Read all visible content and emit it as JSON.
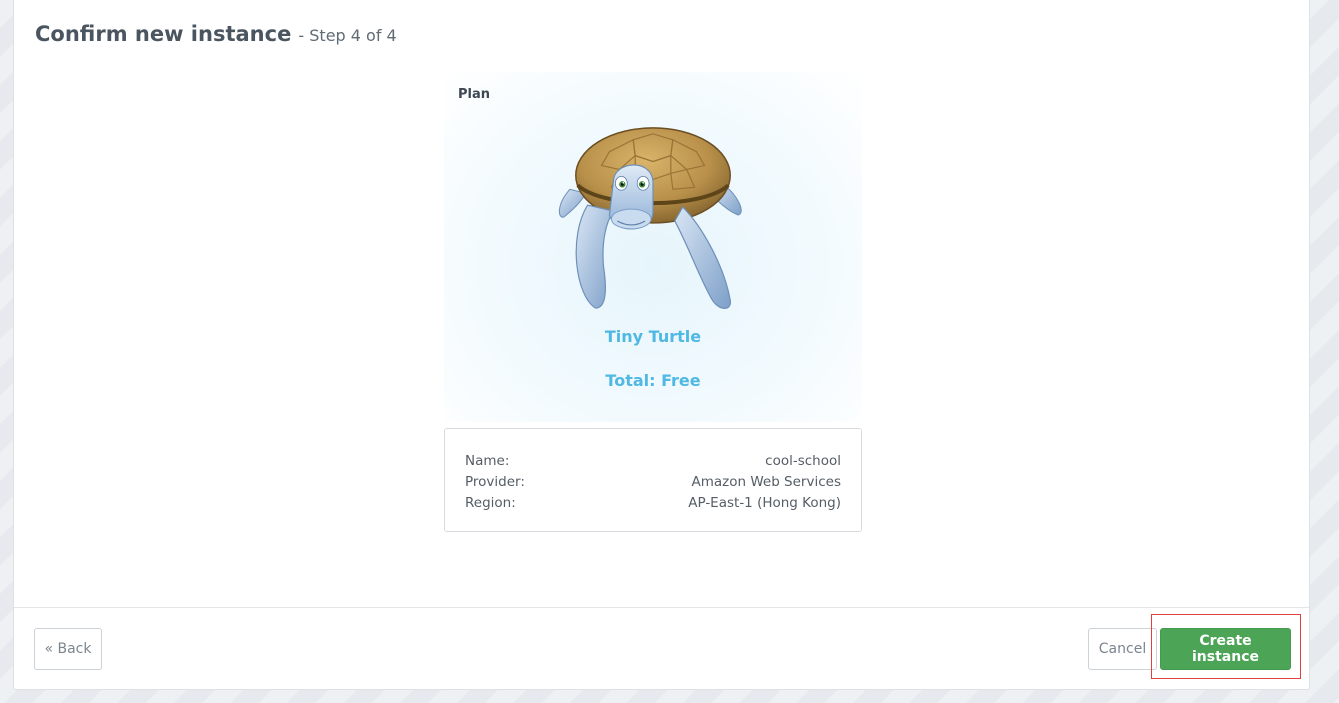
{
  "header": {
    "title": "Confirm new instance",
    "step": "- Step 4 of 4"
  },
  "plan": {
    "label": "Plan",
    "name": "Tiny Turtle",
    "total": "Total: Free",
    "image_icon": "turtle-mascot-icon"
  },
  "details": [
    {
      "label": "Name:",
      "value": "cool-school"
    },
    {
      "label": "Provider:",
      "value": "Amazon Web Services"
    },
    {
      "label": "Region:",
      "value": "AP-East-1 (Hong Kong)"
    }
  ],
  "footer": {
    "back_label": "« Back",
    "cancel_label": "Cancel",
    "create_label": "Create instance"
  },
  "colors": {
    "accent": "#4fb8e3",
    "primary_button": "#4ca556",
    "highlight": "#e0413f"
  }
}
